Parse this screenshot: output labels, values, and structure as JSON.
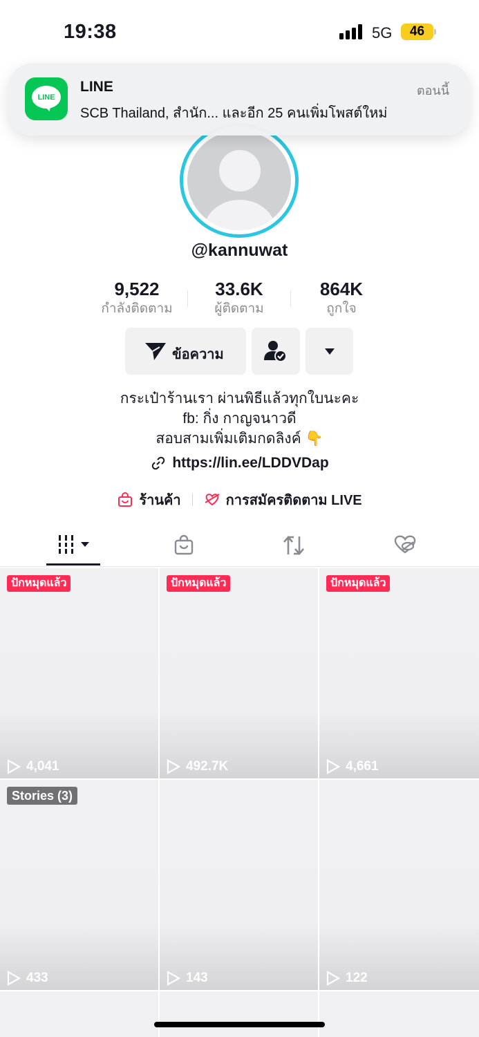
{
  "status_bar": {
    "time": "19:38",
    "network": "5G",
    "battery": "46"
  },
  "notification": {
    "app_icon_text": "LINE",
    "app_name": "LINE",
    "time": "ตอนนี้",
    "body": "SCB Thailand, สำนัก... และอีก 25 คนเพิ่มโพสต์ใหม่"
  },
  "profile": {
    "username": "@kannuwat",
    "stats": [
      {
        "value": "9,522",
        "label": "กำลังติดตาม"
      },
      {
        "value": "33.6K",
        "label": "ผู้ติดตาม"
      },
      {
        "value": "864K",
        "label": "ถูกใจ"
      }
    ],
    "message_button": "ข้อความ",
    "bio_lines": [
      "กระเป๋าร้านเรา ผ่านพิธีแล้วทุกใบนะคะ",
      "fb: กิ่ง กาญจนาวดี",
      "สอบสามเพิ่มเติมกดลิงค์ 👇"
    ],
    "link": "https://lin.ee/LDDVDap",
    "shop_label": "ร้านค้า",
    "live_label": "การสมัครติดตาม LIVE"
  },
  "tabs": [
    "videos-grid",
    "shop",
    "reposts",
    "liked-private"
  ],
  "videos": [
    {
      "badge": "ปักหมุดแล้ว",
      "views": "4,041"
    },
    {
      "badge": "ปักหมุดแล้ว",
      "views": "492.7K"
    },
    {
      "badge": "ปักหมุดแล้ว",
      "views": "4,661"
    },
    {
      "badge": "Stories (3)",
      "views": "433"
    },
    {
      "badge": "",
      "views": "143"
    },
    {
      "badge": "",
      "views": "122"
    }
  ],
  "colors": {
    "accent": "#fe2c55",
    "avatar_ring": "#2bc6e0",
    "line_green": "#06c755",
    "battery": "#f7cd1f"
  }
}
